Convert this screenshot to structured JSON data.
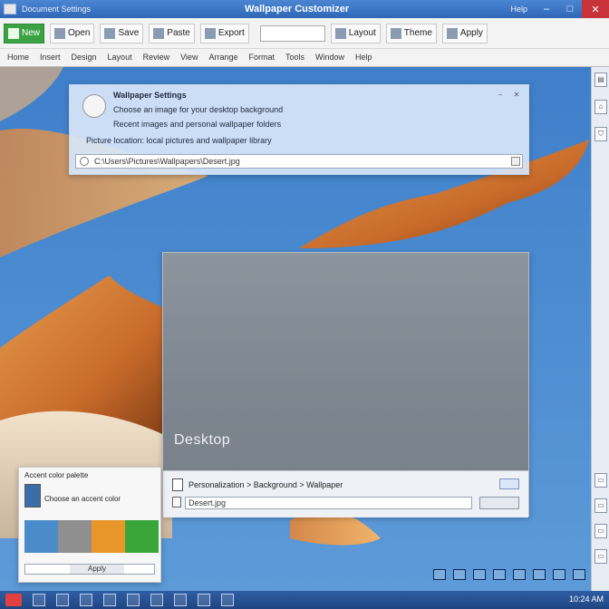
{
  "app": {
    "title": "Wallpaper Customizer",
    "quick_access": "Document Settings",
    "help": "Help"
  },
  "ribbon": {
    "buttons": [
      "New",
      "Open",
      "Save",
      "Paste",
      "Export",
      "Layout",
      "Theme",
      "Apply"
    ],
    "tabs": [
      "Home",
      "Insert",
      "Design",
      "Layout",
      "Review",
      "View",
      "Arrange",
      "Format",
      "Tools",
      "Window",
      "Help"
    ]
  },
  "dialog_top": {
    "line1": "Wallpaper Settings",
    "line2": "Choose an image for your desktop background",
    "line3": "Recent images and personal wallpaper folders",
    "line4": "Picture location: local pictures and wallpaper library",
    "address": "C:\\Users\\Pictures\\Wallpapers\\Desert.jpg"
  },
  "viewer": {
    "brand": "Desktop",
    "crumb": "Personalization > Background > Wallpaper",
    "input": "Desert.jpg"
  },
  "swatch_panel": {
    "header": "Accent color palette",
    "desc": "Choose an accent color",
    "footer_button": "Apply",
    "colors": [
      "#4a8cc9",
      "#8f8f8f",
      "#e8962a",
      "#3aa63a"
    ]
  },
  "taskbar": {
    "clock": "10:24 AM"
  },
  "colors": {
    "accent": "#2f67b8",
    "close": "#c8333a"
  }
}
